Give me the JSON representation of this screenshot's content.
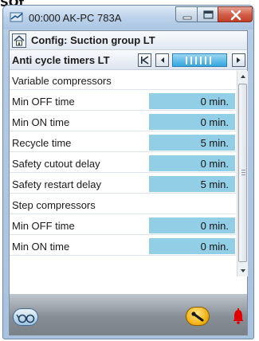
{
  "top_fragment": "SOf",
  "window": {
    "title": "00:000 AK-PC 783A"
  },
  "header": {
    "title": "Config: Suction group LT"
  },
  "subheader": {
    "title": "Anti cycle timers LT"
  },
  "rows": [
    {
      "label": "Variable compressors",
      "value": ""
    },
    {
      "label": "Min OFF time",
      "value": "0 min."
    },
    {
      "label": "Min ON time",
      "value": "0 min."
    },
    {
      "label": "Recycle time",
      "value": "5 min."
    },
    {
      "label": "Safety cutout delay",
      "value": "0 min."
    },
    {
      "label": "Safety restart delay",
      "value": "5 min."
    },
    {
      "label": "Step compressors",
      "value": ""
    },
    {
      "label": "Min OFF time",
      "value": "0 min."
    },
    {
      "label": "Min ON time",
      "value": "0 min."
    }
  ],
  "colors": {
    "value_cell": "#92cfe7",
    "page_bar": "#34a6df",
    "close_button": "#c23f29",
    "alarm": "#e00000",
    "tools_button": "#f2b51a"
  },
  "icons": {
    "app": "app-icon",
    "home": "home-icon",
    "first": "first-page-icon",
    "prev": "prev-page-icon",
    "next": "next-page-icon",
    "glasses": "glasses-icon",
    "tools": "wrench-icon",
    "alarm": "alarm-bell-icon"
  }
}
